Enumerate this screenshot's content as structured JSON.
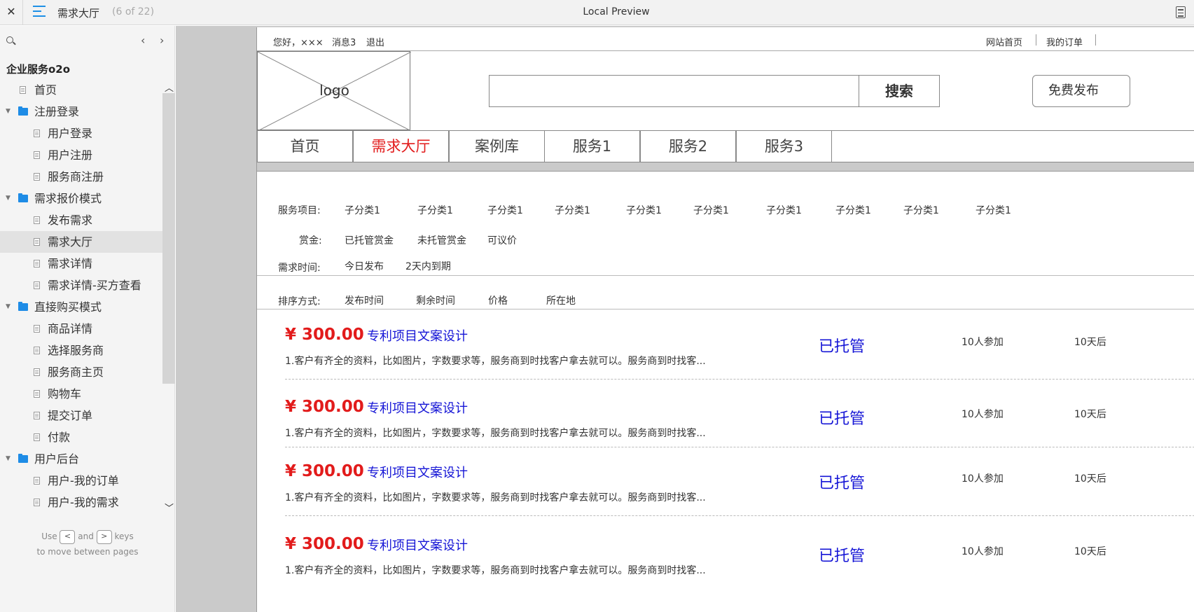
{
  "topbar": {
    "close_glyph": "✕",
    "page_title": "需求大厅",
    "page_count": "(6 of 22)",
    "window_title": "Local Preview"
  },
  "sidebar": {
    "project_name": "企业服务o2o",
    "prev_glyph": "‹",
    "next_glyph": "›",
    "tree": [
      {
        "label": "首页",
        "type": "page",
        "level": 1
      },
      {
        "label": "注册登录",
        "type": "folder",
        "level": 0
      },
      {
        "label": "用户登录",
        "type": "page",
        "level": 2
      },
      {
        "label": "用户注册",
        "type": "page",
        "level": 2
      },
      {
        "label": "服务商注册",
        "type": "page",
        "level": 2
      },
      {
        "label": "需求报价模式",
        "type": "folder",
        "level": 0
      },
      {
        "label": "发布需求",
        "type": "page",
        "level": 2
      },
      {
        "label": "需求大厅",
        "type": "page",
        "level": 2,
        "selected": true
      },
      {
        "label": "需求详情",
        "type": "page",
        "level": 2
      },
      {
        "label": "需求详情-买方查看",
        "type": "page",
        "level": 2
      },
      {
        "label": "直接购买模式",
        "type": "folder",
        "level": 0
      },
      {
        "label": "商品详情",
        "type": "page",
        "level": 2
      },
      {
        "label": "选择服务商",
        "type": "page",
        "level": 2
      },
      {
        "label": "服务商主页",
        "type": "page",
        "level": 2
      },
      {
        "label": "购物车",
        "type": "page",
        "level": 2
      },
      {
        "label": "提交订单",
        "type": "page",
        "level": 2
      },
      {
        "label": "付款",
        "type": "page",
        "level": 2
      },
      {
        "label": "用户后台",
        "type": "folder",
        "level": 0
      },
      {
        "label": "用户-我的订单",
        "type": "page",
        "level": 2
      },
      {
        "label": "用户-我的需求",
        "type": "page",
        "level": 2
      }
    ],
    "hint": {
      "use": "Use",
      "key_prev": "<",
      "and": "and",
      "key_next": ">",
      "keys": "keys",
      "line2": "to move between pages"
    }
  },
  "page": {
    "util": {
      "greeting": "您好，×××",
      "messages": "消息3",
      "logout": "退出",
      "home_link": "网站首页",
      "my_orders": "我的订单"
    },
    "logo_text": "logo",
    "search_button": "搜索",
    "publish_button": "免费发布",
    "nav": [
      {
        "label": "首页",
        "active": false
      },
      {
        "label": "需求大厅",
        "active": true
      },
      {
        "label": "案例库",
        "active": false
      },
      {
        "label": "服务1",
        "active": false
      },
      {
        "label": "服务2",
        "active": false
      },
      {
        "label": "服务3",
        "active": false
      }
    ],
    "filters": {
      "service_label": "服务项目:",
      "service_options": [
        "子分类1",
        "子分类1",
        "子分类1",
        "子分类1",
        "子分类1",
        "子分类1",
        "子分类1",
        "子分类1",
        "子分类1",
        "子分类1"
      ],
      "reward_label": "赏金:",
      "reward_options": [
        "已托管赏金",
        "未托管赏金",
        "可议价"
      ],
      "time_label": "需求时间:",
      "time_options": [
        "今日发布",
        "2天内到期"
      ],
      "sort_label": "排序方式:",
      "sort_options": [
        "发布时间",
        "剩余时间",
        "价格",
        "所在地"
      ]
    },
    "items": [
      {
        "price": "¥ 300.00",
        "title": "专利项目文案设计",
        "desc": "1.客户有齐全的资料，比如图片，字数要求等，服务商到时找客户拿去就可以。服务商到时找客...",
        "status": "已托管",
        "joined": "10人参加",
        "days": "10天后"
      },
      {
        "price": "¥ 300.00",
        "title": "专利项目文案设计",
        "desc": "1.客户有齐全的资料，比如图片，字数要求等，服务商到时找客户拿去就可以。服务商到时找客...",
        "status": "已托管",
        "joined": "10人参加",
        "days": "10天后"
      },
      {
        "price": "¥ 300.00",
        "title": "专利项目文案设计",
        "desc": "1.客户有齐全的资料，比如图片，字数要求等，服务商到时找客户拿去就可以。服务商到时找客...",
        "status": "已托管",
        "joined": "10人参加",
        "days": "10天后"
      },
      {
        "price": "¥ 300.00",
        "title": "专利项目文案设计",
        "desc": "1.客户有齐全的资料，比如图片，字数要求等，服务商到时找客户拿去就可以。服务商到时找客...",
        "status": "已托管",
        "joined": "10人参加",
        "days": "10天后"
      }
    ]
  }
}
